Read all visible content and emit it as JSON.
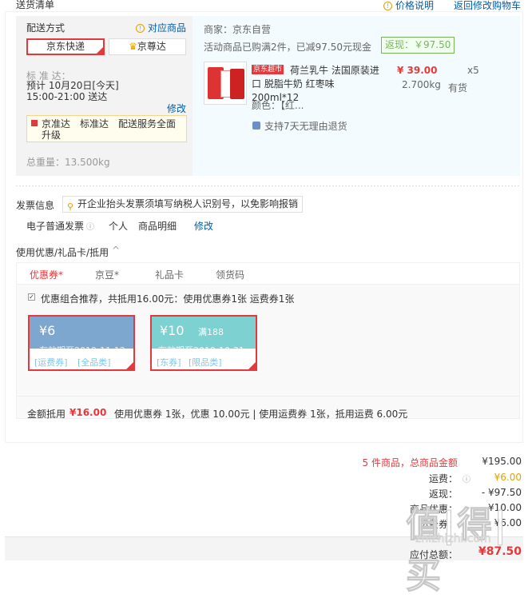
{
  "header": {
    "title": "送货清单",
    "price_info": "价格说明",
    "back_link": "返回修改购物车"
  },
  "delivery": {
    "method_label": "配送方式",
    "matching_label": "对应商品",
    "options": [
      "京东快递",
      "京尊达"
    ],
    "standard_label": "标 准 达：",
    "eta": "预计 10月20日[今天] 15:00-21:00 送达",
    "edit": "修改",
    "notice": "京准达　标准达　配送服务全面升级",
    "weight": "总重量：13.500kg"
  },
  "seller": {
    "name": "商家：京东自营",
    "promo": "活动商品已购满2件，已减97.50元现金",
    "rebate": "返现：￥97.50",
    "product": {
      "badge": "京东超市",
      "title": "荷兰乳牛 法国原装进口 脱脂牛奶 红枣味 200ml*12",
      "price": "¥ 39.00",
      "qty": "x5",
      "weight": "2.700kg",
      "stock": "有货",
      "color": "颜色：【红...",
      "return": "支持7天无理由退货"
    }
  },
  "invoice": {
    "label": "发票信息",
    "tip": "开企业抬头发票须填写纳税人识别号，以免影响报销",
    "type": "电子普通发票",
    "personal": "个人",
    "detail": "商品明细",
    "edit": "修改"
  },
  "discount": {
    "title": "使用优惠/礼品卡/抵用",
    "tabs": [
      "优惠券*",
      "京豆*",
      "礼品卡",
      "领货码"
    ],
    "recommend": "优惠组合推荐，共抵用16.00元：使用优惠券1张 运费券1张",
    "coupons": [
      {
        "amount": "¥6",
        "cond": "",
        "valid": "有效期至2019-11-12",
        "tags": [
          "[运费券]",
          "[全品类]"
        ],
        "color": "#7ea7cf"
      },
      {
        "amount": "¥10",
        "cond": "满188",
        "valid": "有效期至2019-10-31",
        "tags": [
          "[东券]",
          "[限品类]"
        ],
        "color": "#7dd1d1"
      }
    ],
    "summary_label": "金额抵用",
    "summary_amount": "¥16.00",
    "summary_text": "使用优惠券 1张，优惠 10.00元 | 使用运费券 1张，抵用运费 6.00元"
  },
  "totals": {
    "count_label": "5 件商品，总商品金额",
    "total": "¥195.00",
    "shipping_label": "运费：",
    "shipping": "¥6.00",
    "rebate_label": "返现：",
    "rebate": "- ¥97.50",
    "row4_label": "商品优惠：",
    "row4": "- ¥10.00",
    "row5_label": "运费券：",
    "row5": "- ¥6.00",
    "payable_label": "应付总额：",
    "payable": "¥87.50"
  },
  "watermark": {
    "text": "值|得|买",
    "url": "zhizhizhi.com"
  }
}
